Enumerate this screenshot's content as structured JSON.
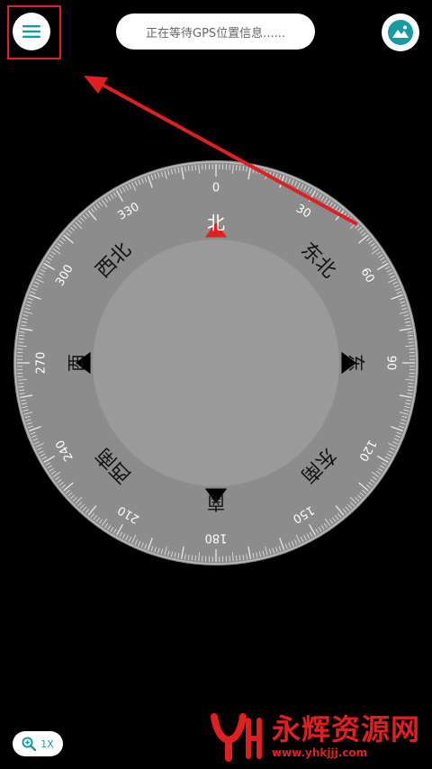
{
  "header": {
    "menu_icon": "hamburger-menu-icon",
    "status_text": "正在等待GPS位置信息......",
    "map_icon": "landscape-icon"
  },
  "compass": {
    "degree_labels": [
      "0",
      "30",
      "60",
      "90",
      "120",
      "150",
      "180",
      "210",
      "240",
      "270",
      "300",
      "330"
    ],
    "directions": {
      "north": "北",
      "northeast": "东北",
      "east": "东",
      "southeast": "东南",
      "south": "南",
      "southwest": "西南",
      "west": "西",
      "northwest": "西北"
    },
    "colors": {
      "ring": "#8c8c8c",
      "face": "#9a9a9a",
      "north_marker": "#e02020"
    }
  },
  "zoom": {
    "icon": "zoom-in-icon",
    "label": "1X"
  },
  "watermark": {
    "title": "永辉资源网",
    "url": "www.yhkjjj.com"
  },
  "accent_color": "#1a9aa0",
  "annotation_color": "#e02020"
}
